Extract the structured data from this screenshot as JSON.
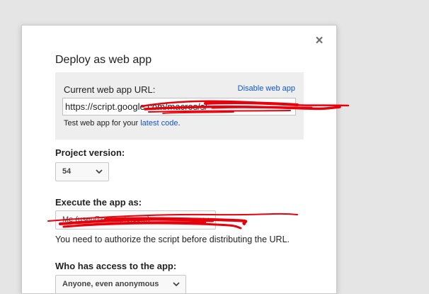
{
  "dialog": {
    "title": "Deploy as web app",
    "close_icon": "×"
  },
  "url_section": {
    "label": "Current web app URL:",
    "disable_link": "Disable web app",
    "url_value": "https://script.google.com/macros/s/",
    "test_text": "Test web app for your ",
    "test_link": "latest code",
    "test_suffix": "."
  },
  "project_version": {
    "label": "Project version:",
    "selected": "54"
  },
  "execute_as": {
    "label": "Execute the app as:",
    "selected": "Me (user@example.com)",
    "note": "You need to authorize the script before distributing the URL."
  },
  "access": {
    "label": "Who has access to the app:",
    "selected": "Anyone, even anonymous"
  },
  "colors": {
    "redaction": "#e8000b",
    "link": "#1155cc"
  }
}
